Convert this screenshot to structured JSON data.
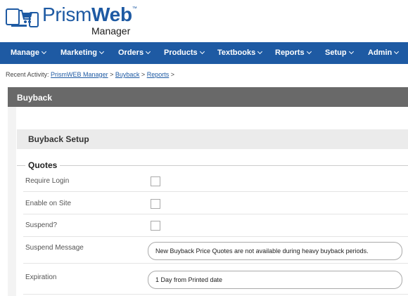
{
  "brand": {
    "name_prism": "Prism",
    "name_web": "Web",
    "trademark": "™",
    "subtitle": "Manager"
  },
  "nav": {
    "items": [
      {
        "label": "Manage"
      },
      {
        "label": "Marketing"
      },
      {
        "label": "Orders"
      },
      {
        "label": "Products"
      },
      {
        "label": "Textbooks"
      },
      {
        "label": "Reports"
      },
      {
        "label": "Setup"
      },
      {
        "label": "Admin"
      }
    ]
  },
  "breadcrumb": {
    "prefix": "Recent Activity:",
    "links": [
      "PrismWEB Manager",
      "Buyback",
      "Reports"
    ],
    "separator": ">"
  },
  "page": {
    "title": "Buyback"
  },
  "setup": {
    "title": "Buyback Setup"
  },
  "quotes": {
    "legend": "Quotes",
    "require_login_label": "Require Login",
    "enable_on_site_label": "Enable on Site",
    "suspend_label": "Suspend?",
    "suspend_message_label": "Suspend Message",
    "suspend_message_value": "New Buyback Price Quotes are not available during heavy buyback periods.",
    "expiration_label": "Expiration",
    "expiration_value": "1 Day from Printed date"
  },
  "colors": {
    "brand_blue": "#1e5aa3",
    "section_bar": "#696969",
    "setup_bar": "#ebebeb"
  }
}
